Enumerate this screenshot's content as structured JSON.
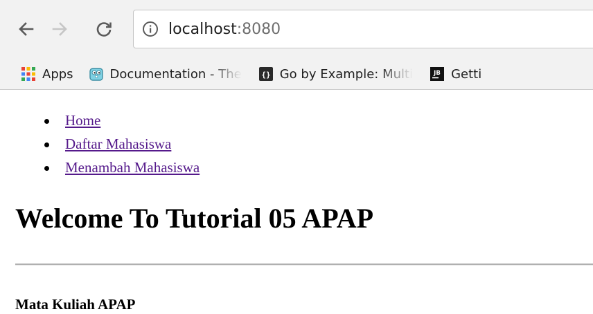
{
  "browser": {
    "url_host": "localhost",
    "url_port": ":8080",
    "bookmarks": {
      "apps": "Apps",
      "documentation": "Documentation - The",
      "go_by_example": "Go by Example: Multi",
      "getting": "Getti"
    },
    "icons": {
      "back": "back-arrow-icon",
      "forward": "forward-arrow-icon",
      "reload": "reload-icon",
      "info": "info-icon",
      "apps": "apps-grid-icon",
      "documentation": "gopher-icon",
      "go_by_example": "braces-icon",
      "getting": "jetbrains-icon"
    }
  },
  "page": {
    "nav": [
      {
        "label": "Home"
      },
      {
        "label": "Daftar Mahasiswa"
      },
      {
        "label": "Menambah Mahasiswa"
      }
    ],
    "title": "Welcome To Tutorial 05 APAP",
    "section_heading": "Mata Kuliah APAP"
  },
  "colors": {
    "link_visited": "#551a8b",
    "chrome_bg": "#f2f2f2"
  }
}
